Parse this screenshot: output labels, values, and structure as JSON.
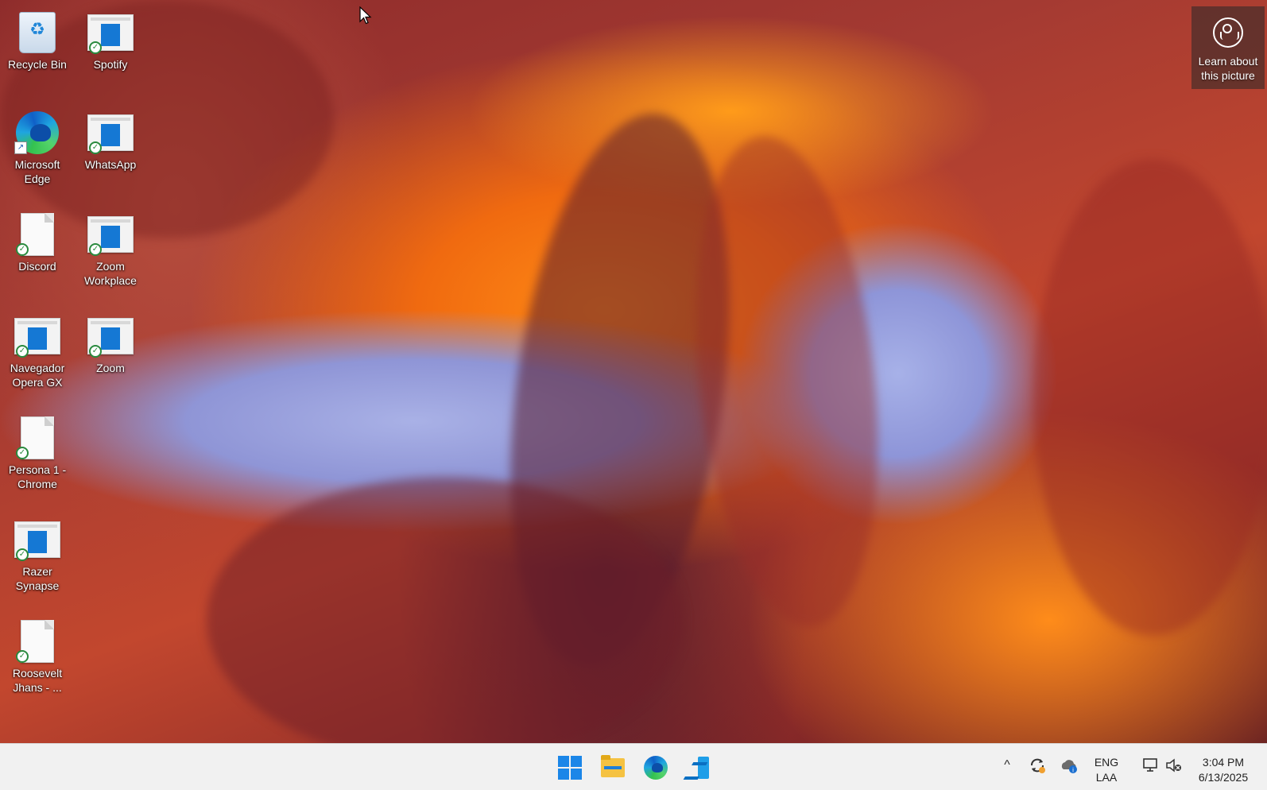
{
  "desktop": {
    "icons": [
      {
        "label": "Recycle Bin",
        "icon": "recycle-bin-icon"
      },
      {
        "label": "Spotify",
        "icon": "app-icon"
      },
      {
        "label": "Microsoft Edge",
        "icon": "edge-icon"
      },
      {
        "label": "WhatsApp",
        "icon": "app-icon"
      },
      {
        "label": "Discord",
        "icon": "document-icon"
      },
      {
        "label": "Zoom Workplace",
        "icon": "app-icon"
      },
      {
        "label": "Navegador Opera GX",
        "icon": "app-icon"
      },
      {
        "label": "Zoom",
        "icon": "app-icon"
      },
      {
        "label": "Persona 1 - Chrome",
        "icon": "document-icon"
      },
      {
        "label": "Razer Synapse",
        "icon": "app-icon"
      },
      {
        "label": "Roosevelt Jhans - ...",
        "icon": "document-icon"
      }
    ],
    "learn_about_picture": "Learn about this picture"
  },
  "taskbar": {
    "pinned": [
      "start-icon",
      "file-explorer-icon",
      "edge-icon",
      "vscode-icon"
    ],
    "tray": {
      "chevron": "^",
      "lang_line1": "ENG",
      "lang_line2": "LAA",
      "time": "3:04 PM",
      "date": "6/13/2025"
    }
  },
  "colors": {
    "taskbar_bg": "#f1f1f1",
    "accent": "#1b86e8"
  }
}
